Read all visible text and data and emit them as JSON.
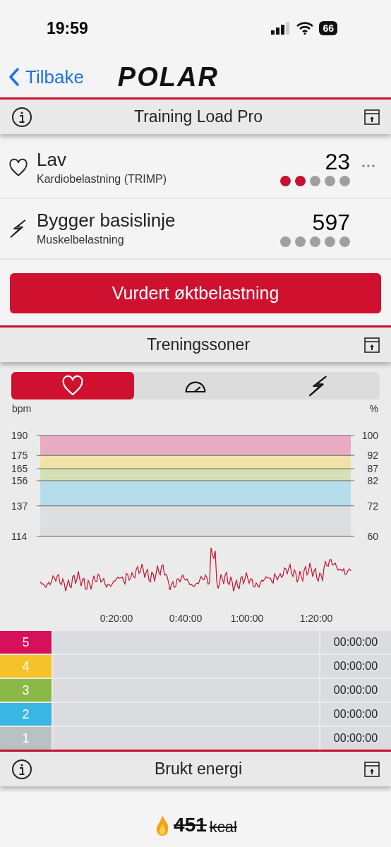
{
  "status_bar": {
    "time": "19:59",
    "battery": "66"
  },
  "nav": {
    "back": "Tilbake",
    "logo": "POLAR"
  },
  "training_load": {
    "title": "Training Load Pro",
    "rows": [
      {
        "kind": "heart",
        "title": "Lav",
        "subtitle": "Kardiobelastning (TRIMP)",
        "value": "23",
        "stars": 2,
        "more": true
      },
      {
        "kind": "bolt",
        "title": "Bygger basislinje",
        "subtitle": "Muskelbelastning",
        "value": "597",
        "stars": 0,
        "more": false
      }
    ],
    "button": "Vurdert øktbelastning"
  },
  "zones": {
    "title": "Treningssoner",
    "tabs": [
      {
        "kind": "heart",
        "selected": true
      },
      {
        "kind": "gauge",
        "selected": false
      },
      {
        "kind": "bolt",
        "selected": false
      }
    ],
    "left_unit": "bpm",
    "right_unit": "%",
    "ticks": [
      {
        "bpm": "190",
        "pct": "100"
      },
      {
        "bpm": "175",
        "pct": "92"
      },
      {
        "bpm": "165",
        "pct": "87"
      },
      {
        "bpm": "156",
        "pct": "82"
      },
      {
        "bpm": "137",
        "pct": "72"
      },
      {
        "bpm": "114",
        "pct": "60"
      }
    ],
    "x_labels": [
      "0:20:00",
      "0:40:00",
      "1:00:00",
      "1:20:00"
    ],
    "table": [
      {
        "zone": "5",
        "color": "#d6105a",
        "time": "00:00:00"
      },
      {
        "zone": "4",
        "color": "#f5c22a",
        "time": "00:00:00"
      },
      {
        "zone": "3",
        "color": "#8cb846",
        "time": "00:00:00"
      },
      {
        "zone": "2",
        "color": "#3ab6e2",
        "time": "00:00:00"
      },
      {
        "zone": "1",
        "color": "#b8c1c3",
        "time": "00:00:00"
      }
    ]
  },
  "energy": {
    "title": "Brukt energi",
    "value": "451",
    "unit": "kcal"
  }
}
